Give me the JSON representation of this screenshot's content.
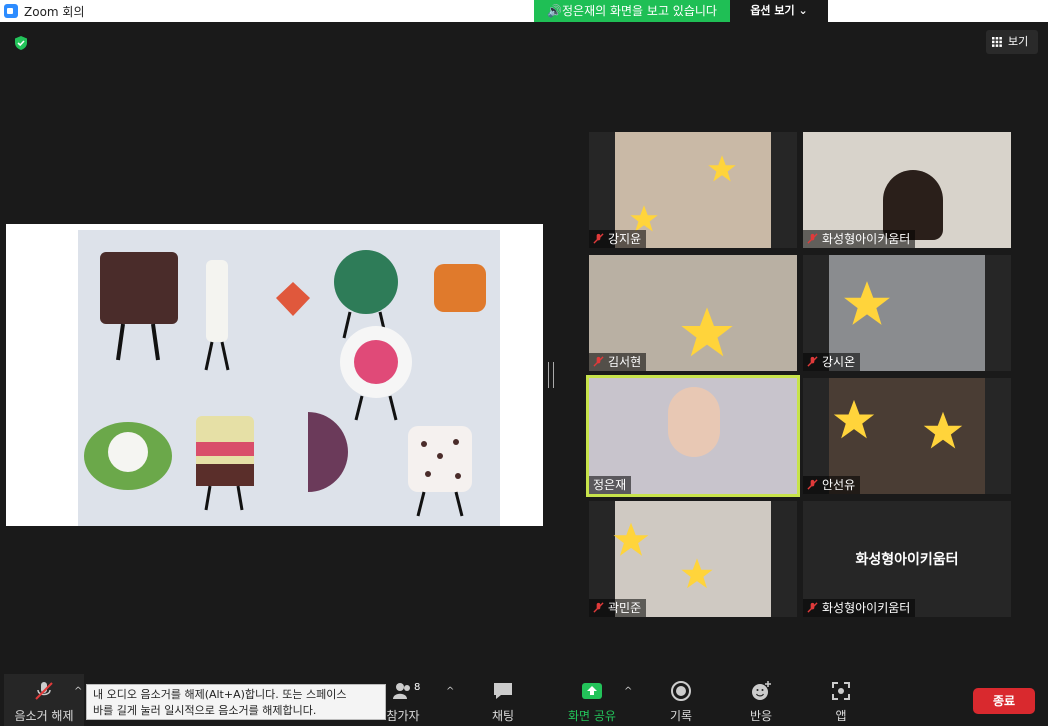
{
  "window": {
    "app_title": "Zoom 회의"
  },
  "banner": {
    "sharing_text": "🔊정은재의 화면을 보고 있습니다",
    "view_options": "옵션 보기 ⌄"
  },
  "top_right": {
    "view_label": "보기"
  },
  "gallery": {
    "tiles": [
      {
        "name": "강지윤",
        "muted": true
      },
      {
        "name": "화성형아이키움터",
        "muted": true
      },
      {
        "name": "김서현",
        "muted": true
      },
      {
        "name": "강시온",
        "muted": true
      },
      {
        "name": "정은재",
        "muted": false,
        "active": true
      },
      {
        "name": "안선유",
        "muted": true
      },
      {
        "name": "곽민준",
        "muted": true
      },
      {
        "name": "화성형아이키움터",
        "muted": true,
        "video_off": true,
        "center_label": "화성형아이키움터"
      }
    ]
  },
  "toolbar": {
    "unmute_label": "음소거 해제",
    "participants_label": "참가자",
    "participants_count": "8",
    "chat_label": "채팅",
    "share_label": "화면 공유",
    "record_label": "기록",
    "reactions_label": "반응",
    "apps_label": "앱",
    "end_label": "종료"
  },
  "tooltip": {
    "line1": "내 오디오 음소거를 해제(Alt+A)합니다. 또는 스페이스",
    "line2": "바를 길게 눌러 일시적으로 음소거를 해제합니다."
  },
  "colors": {
    "active_speaker": "#c7e34b",
    "end_button": "#d9292e",
    "share_banner": "#1fbf55"
  }
}
